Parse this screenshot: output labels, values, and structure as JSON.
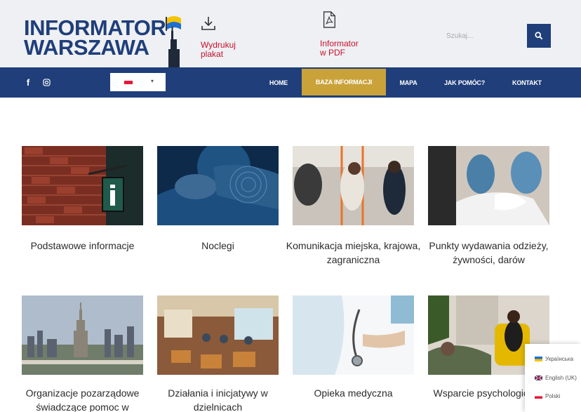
{
  "brand": {
    "line1": "INFORMATOR",
    "line2": "WARSZAWA"
  },
  "header": {
    "print_label": "Wydrukuj\nplakat",
    "pdf_label": "Informator\nw PDF",
    "search_placeholder": "Szukaj...",
    "icons": {
      "print": "download-icon",
      "pdf": "pdf-file-icon",
      "search": "search-icon"
    }
  },
  "nav": {
    "lang_selected": "Polski",
    "items": [
      "HOME",
      "BAZA INFORMACJI",
      "MAPA",
      "JAK POMÓC?",
      "KONTAKT"
    ],
    "active": "BAZA INFORMACJI",
    "social": [
      "facebook-icon",
      "instagram-icon"
    ]
  },
  "tiles": [
    {
      "title": "Podstawowe informacje",
      "image": "info-sign-on-brick-wall"
    },
    {
      "title": "Noclegi",
      "image": "person-sleeping"
    },
    {
      "title": "Komunikacja miejska, krajowa, zagraniczna",
      "image": "people-in-tram"
    },
    {
      "title": "Punkty wydawania odzieży, żywności, darów",
      "image": "volunteers-sorting-donations"
    },
    {
      "title": "Organizacje pozarządowe świadczące pomoc w",
      "image": "warsaw-skyline"
    },
    {
      "title": "Działania i inicjatywy w dzielnicach",
      "image": "community-hall"
    },
    {
      "title": "Opieka medyczna",
      "image": "doctor-with-stethoscope"
    },
    {
      "title": "Wsparcie psychologiczne",
      "image": "therapy-session"
    }
  ],
  "lang_popup": [
    {
      "label": "Українська",
      "flag": "ua-flag-icon"
    },
    {
      "label": "English (UK)",
      "flag": "uk-flag-icon"
    },
    {
      "label": "Polski",
      "flag": "pl-flag-icon"
    }
  ],
  "colors": {
    "brand_blue": "#1f3e7a",
    "accent_gold": "#c9a23a",
    "link_red": "#c8102e"
  }
}
